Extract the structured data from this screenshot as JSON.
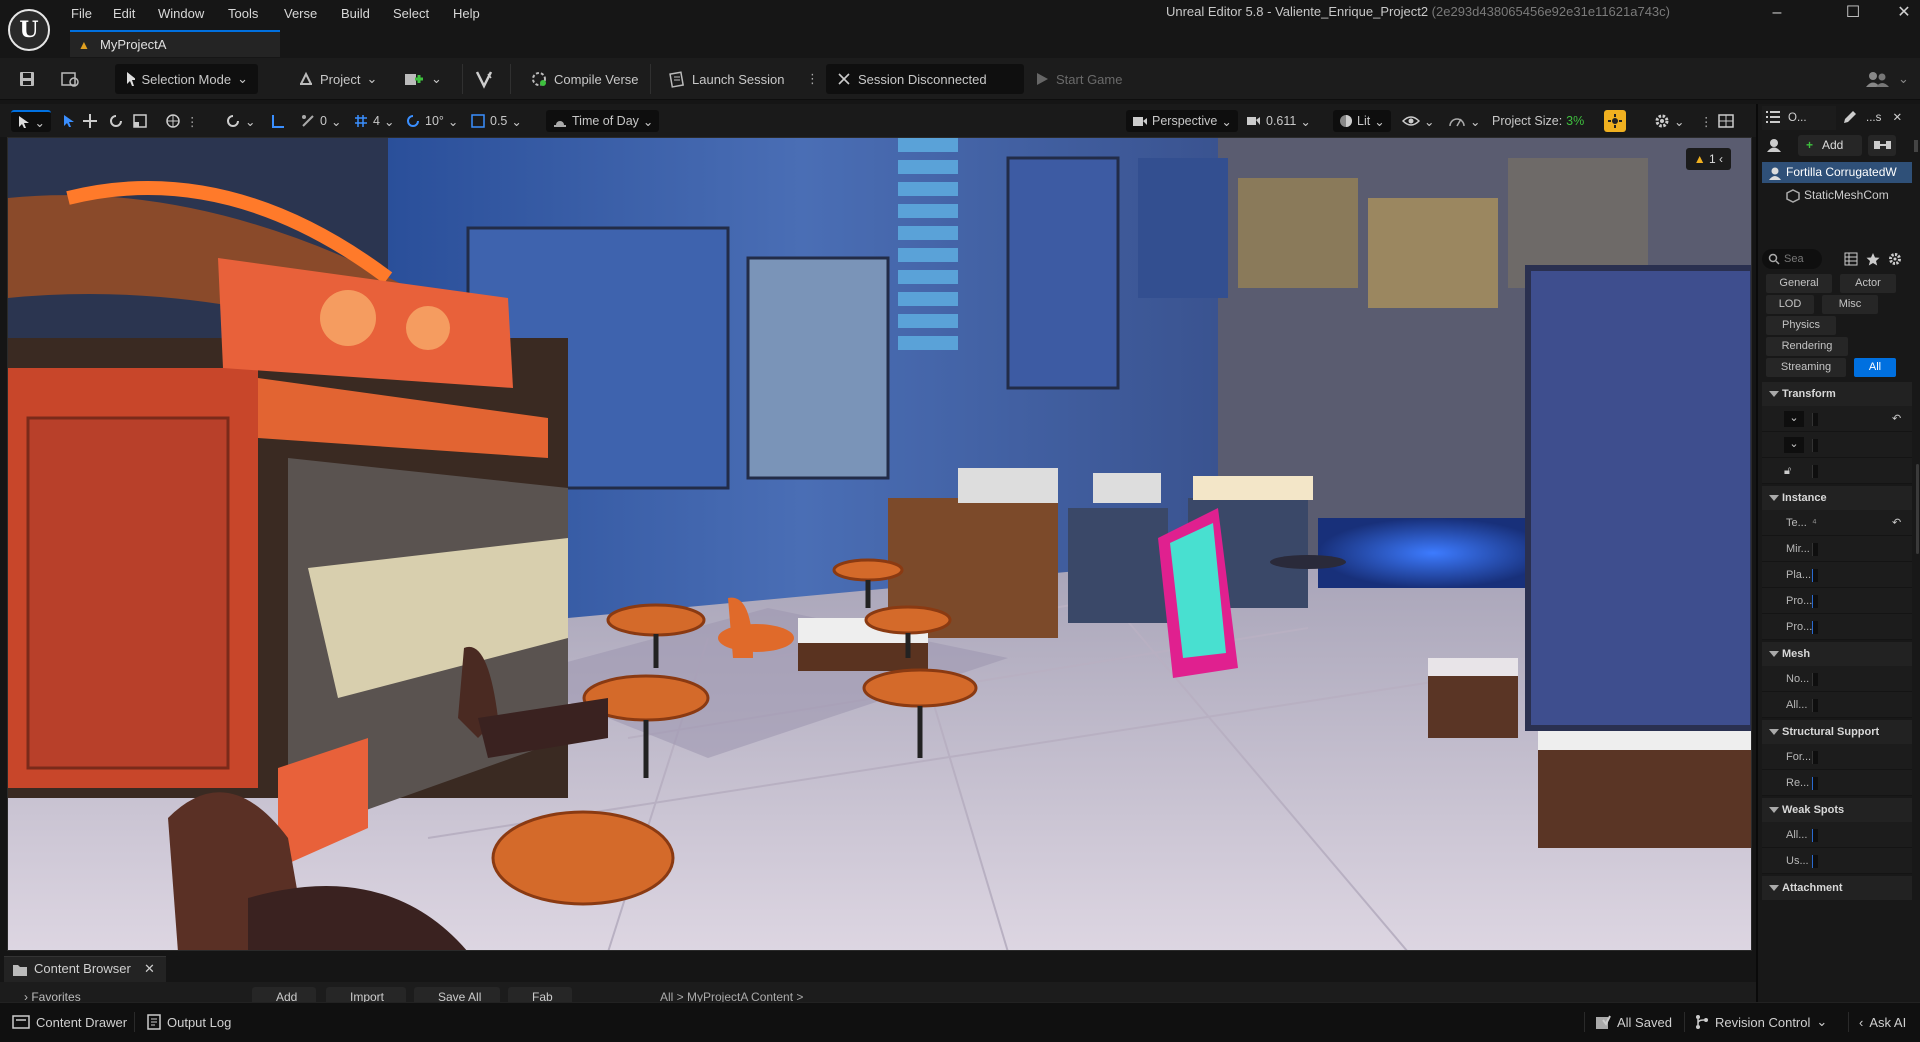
{
  "window": {
    "title": "Unreal Editor 5.8 - Valiente_Enrique_Project2",
    "hash": "(2e293d438065456e92e31e11621a743c)",
    "logo_text": "U",
    "project_tab": "MyProjectA"
  },
  "menu": [
    "File",
    "Edit",
    "Window",
    "Tools",
    "Verse",
    "Build",
    "Select",
    "Help"
  ],
  "toolbar": {
    "mode": "Selection Mode",
    "project": "Project",
    "compile": "Compile Verse",
    "launch": "Launch Session",
    "session": "Session Disconnected",
    "start": "Start Game"
  },
  "viewport_toolbar": {
    "snap_rot": "0",
    "grid": "4",
    "angle": "10°",
    "scale": "0.5",
    "time_of_day": "Time of Day",
    "perspective": "Perspective",
    "speed": "0.611",
    "lit": "Lit",
    "project_size_label": "Project Size:",
    "project_size_value": "3%"
  },
  "viewport": {
    "warning_count": "1"
  },
  "details": {
    "tab_outliner": "O...",
    "tab_details": "...s",
    "add": "Add",
    "actor": "Fortilla CorrugatedW",
    "component": "StaticMeshCom",
    "search_placeholder": "Sea",
    "filters": [
      "General",
      "Actor",
      "LOD",
      "Misc",
      "Physics",
      "Rendering",
      "Streaming",
      "All"
    ],
    "categories": {
      "transform": "Transform",
      "instance": "Instance",
      "mesh": "Mesh",
      "structural": "Structural Support",
      "weak": "Weak Spots",
      "attachment": "Attachment"
    },
    "instance_props": [
      "Te...",
      "Mir...",
      "Pla...",
      "Pro...",
      "Pro..."
    ],
    "mesh_props": [
      "No...",
      "All..."
    ],
    "structural_props": [
      "For...",
      "Re..."
    ],
    "weak_props": [
      "All...",
      "Us..."
    ]
  },
  "content_browser": {
    "tab": "Content Browser",
    "add": "Add",
    "import": "Import",
    "save_all": "Save All",
    "fab": "Fab",
    "favorites": "Favorites",
    "path": "All > MyProjectA Content >"
  },
  "statusbar": {
    "content_drawer": "Content Drawer",
    "output_log": "Output Log",
    "all_saved": "All Saved",
    "revision_control": "Revision Control",
    "ask_ai": "Ask AI"
  },
  "colors": {
    "accent": "#0070e0",
    "warning": "#f0b020",
    "project_size": "#3fbf3f"
  }
}
